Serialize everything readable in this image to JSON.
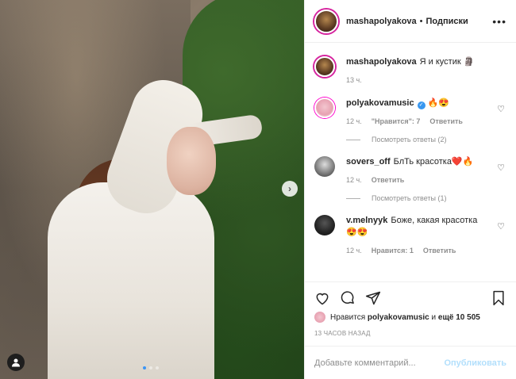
{
  "header": {
    "username": "mashapolyakova",
    "separator": "•",
    "follow_label": "Подписки",
    "more_icon": "more-horizontal-icon"
  },
  "comments": [
    {
      "user": "mashapolyakova",
      "text": "Я и кустик 🗿",
      "time": "13 ч."
    },
    {
      "user": "polyakovamusic",
      "verified": true,
      "text": "🔥😍",
      "time": "12 ч.",
      "likes": "\"Нравится\": 7",
      "reply": "Ответить",
      "replies": "Посмотреть ответы (2)"
    },
    {
      "user": "sovers_off",
      "text": "БлТь красотка❤️🔥",
      "time": "12 ч.",
      "reply": "Ответить",
      "replies": "Посмотреть ответы (1)"
    },
    {
      "user": "v.melnyyk",
      "text": "Боже, какая красотка 😍😍",
      "time": "12 ч.",
      "likes": "Нравится: 1",
      "reply": "Ответить"
    }
  ],
  "likes": {
    "prefix": "Нравится",
    "user": "polyakovamusic",
    "middle": "и",
    "count": "ещё 10 505"
  },
  "timestamp": "13 ЧАСОВ НАЗАД",
  "comment_box": {
    "placeholder": "Добавьте комментарий...",
    "publish": "Опубликовать"
  },
  "carousel": {
    "slides": 3,
    "current": 1
  },
  "colors": {
    "story_ring": "#d6249f",
    "verified": "#3897f0",
    "publish_disabled": "#b2dffc",
    "carousel_active": "#3b95f6"
  }
}
